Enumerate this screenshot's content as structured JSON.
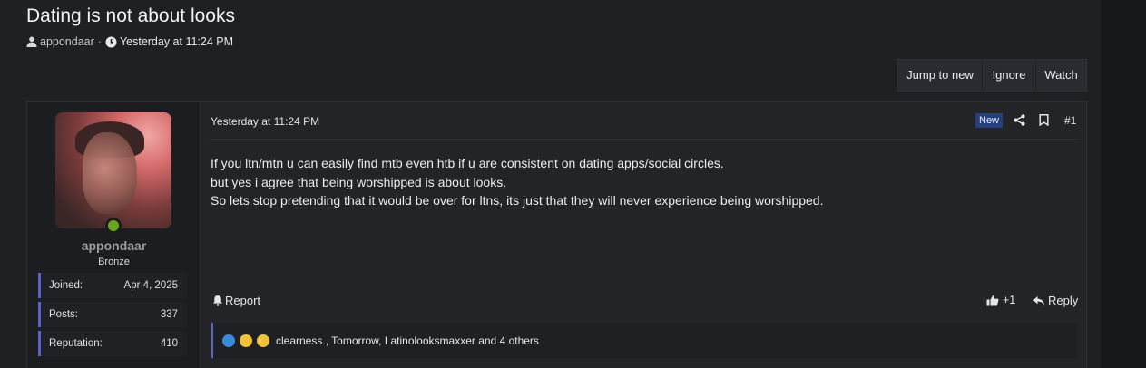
{
  "thread": {
    "title": "Dating is not about looks",
    "author": "appondaar",
    "separator": "·",
    "time": "Yesterday at 11:24 PM"
  },
  "thread_actions": {
    "jump_to_new": "Jump to new",
    "ignore": "Ignore",
    "watch": "Watch"
  },
  "post": {
    "user": {
      "name": "appondaar",
      "rank": "Bronze",
      "stats": [
        {
          "label": "Joined:",
          "value": "Apr 4, 2025"
        },
        {
          "label": "Posts:",
          "value": "337"
        },
        {
          "label": "Reputation:",
          "value": "410"
        }
      ]
    },
    "date": "Yesterday at 11:24 PM",
    "badge": "New",
    "number": "#1",
    "body": [
      "If you ltn/mtn u can easily find mtb even htb if u are consistent on dating apps/social circles.",
      "but yes i agree that being worshipped is about looks.",
      "So lets stop pretending that it would be over for ltns, its just that they will never experience being worshipped."
    ],
    "report_label": "Report",
    "like_label": "+1",
    "reply_label": "Reply",
    "reactions_text": "clearness., Tomorrow, Latinolooksmaxxer and 4 others"
  },
  "colors": {
    "accent": "#5c63c7",
    "online": "#6ea51e",
    "new_badge": "#27407a"
  }
}
